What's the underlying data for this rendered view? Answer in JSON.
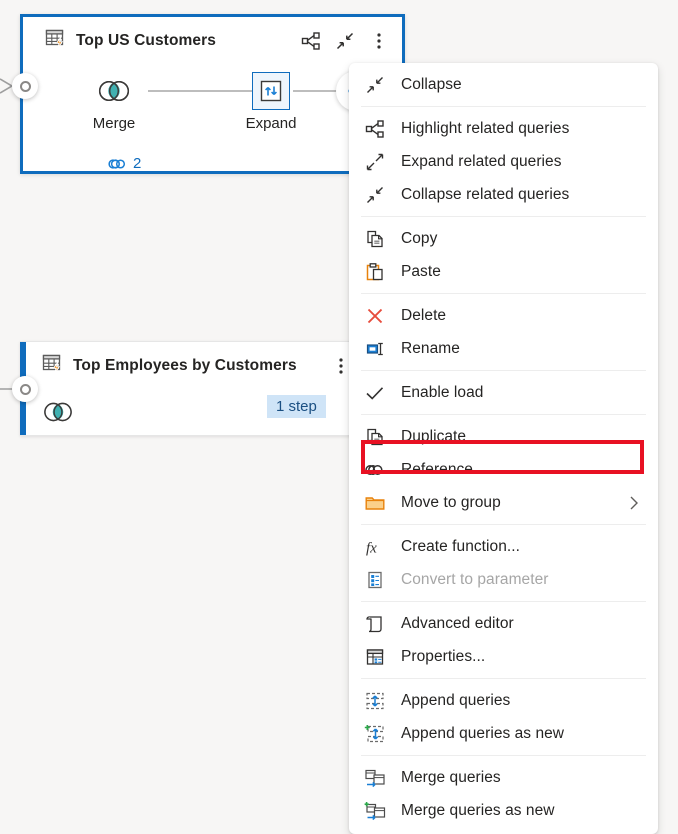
{
  "app": {
    "background_color": "#f7f6f5",
    "accent_color": "#0f6cbd",
    "highlight_color": "#e81123"
  },
  "diagram": {
    "cards": [
      {
        "title": "Top US Customers",
        "icon": "query-table-icon",
        "selected": true,
        "header_actions": [
          {
            "name": "highlight-related-queries-icon",
            "label": "Highlight related queries"
          },
          {
            "name": "collapse-icon",
            "label": "Collapse"
          },
          {
            "name": "more-options-icon",
            "label": "More options"
          }
        ],
        "steps": [
          {
            "label": "Merge",
            "icon": "merge-icon",
            "selected": false
          },
          {
            "label": "Expand",
            "icon": "expand-columns-icon",
            "selected": true
          }
        ],
        "reference_badge": {
          "icon": "link-icon",
          "count": "2"
        },
        "add_step_button": "+"
      },
      {
        "title": "Top Employees by Customers",
        "icon": "query-table-icon",
        "selected": false,
        "header_actions": [
          {
            "name": "more-options-icon",
            "label": "More options"
          }
        ],
        "steps": [
          {
            "label": "",
            "icon": "merge-icon",
            "selected": false
          }
        ],
        "step_badge": "1 step"
      }
    ]
  },
  "context_menu": {
    "highlighted_item": "Reference",
    "groups": [
      {
        "items": [
          {
            "label": "Collapse",
            "icon": "collapse-icon",
            "disabled": false,
            "submenu": false
          }
        ]
      },
      {
        "items": [
          {
            "label": "Highlight related queries",
            "icon": "highlight-related-queries-icon",
            "disabled": false,
            "submenu": false
          },
          {
            "label": "Expand related queries",
            "icon": "expand-related-queries-icon",
            "disabled": false,
            "submenu": false
          },
          {
            "label": "Collapse related queries",
            "icon": "collapse-related-queries-icon",
            "disabled": false,
            "submenu": false
          }
        ]
      },
      {
        "items": [
          {
            "label": "Copy",
            "icon": "copy-icon",
            "disabled": false,
            "submenu": false
          },
          {
            "label": "Paste",
            "icon": "paste-icon",
            "disabled": false,
            "submenu": false
          }
        ]
      },
      {
        "items": [
          {
            "label": "Delete",
            "icon": "delete-icon",
            "disabled": false,
            "submenu": false
          },
          {
            "label": "Rename",
            "icon": "rename-icon",
            "disabled": false,
            "submenu": false
          }
        ]
      },
      {
        "items": [
          {
            "label": "Enable load",
            "icon": "checkmark-icon",
            "disabled": false,
            "submenu": false
          }
        ]
      },
      {
        "items": [
          {
            "label": "Duplicate",
            "icon": "duplicate-icon",
            "disabled": false,
            "submenu": false
          },
          {
            "label": "Reference",
            "icon": "reference-link-icon",
            "disabled": false,
            "submenu": false
          },
          {
            "label": "Move to group",
            "icon": "folder-icon",
            "disabled": false,
            "submenu": true
          }
        ]
      },
      {
        "items": [
          {
            "label": "Create function...",
            "icon": "function-fx-icon",
            "disabled": false,
            "submenu": false
          },
          {
            "label": "Convert to parameter",
            "icon": "parameter-icon",
            "disabled": true,
            "submenu": false
          }
        ]
      },
      {
        "items": [
          {
            "label": "Advanced editor",
            "icon": "advanced-editor-icon",
            "disabled": false,
            "submenu": false
          },
          {
            "label": "Properties...",
            "icon": "properties-icon",
            "disabled": false,
            "submenu": false
          }
        ]
      },
      {
        "items": [
          {
            "label": "Append queries",
            "icon": "append-queries-icon",
            "disabled": false,
            "submenu": false
          },
          {
            "label": "Append queries as new",
            "icon": "append-queries-as-new-icon",
            "disabled": false,
            "submenu": false
          }
        ]
      },
      {
        "items": [
          {
            "label": "Merge queries",
            "icon": "merge-queries-icon",
            "disabled": false,
            "submenu": false
          },
          {
            "label": "Merge queries as new",
            "icon": "merge-queries-as-new-icon",
            "disabled": false,
            "submenu": false
          }
        ]
      }
    ]
  }
}
